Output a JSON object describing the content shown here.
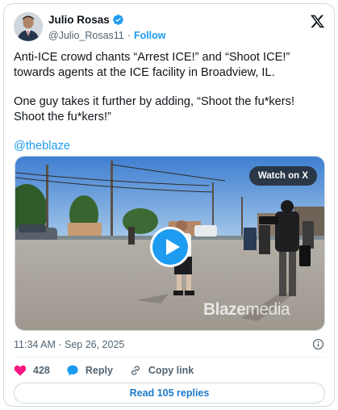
{
  "author": {
    "display_name": "Julio Rosas",
    "handle": "@Julio_Rosas11",
    "separator": "·",
    "follow_label": "Follow"
  },
  "tweet": {
    "paragraph_1": "Anti-ICE crowd chants “Arrest ICE!” and “Shoot ICE!” towards agents at the ICE facility in Broadview, IL.",
    "paragraph_2": "One guy takes it further by adding, “Shoot the fu*kers! Shoot the fu*kers!”",
    "mention": "@theblaze"
  },
  "media": {
    "watch_label": "Watch on X",
    "watermark_bold": "Blaze",
    "watermark_thin": "media"
  },
  "meta": {
    "timestamp": "11:34 AM · Sep 26, 2025"
  },
  "actions": {
    "like_count": "428",
    "reply_label": "Reply",
    "copy_link_label": "Copy link",
    "read_replies_label": "Read 105 replies"
  },
  "colors": {
    "accent": "#1d9bf0",
    "like": "#f91880",
    "text_secondary": "#536471"
  },
  "icons": {
    "verified": "verified-badge-icon",
    "x_logo": "x-logo-icon",
    "play": "play-icon",
    "info": "info-icon",
    "like": "heart-icon",
    "reply": "speech-bubble-icon",
    "copy_link": "link-icon"
  }
}
